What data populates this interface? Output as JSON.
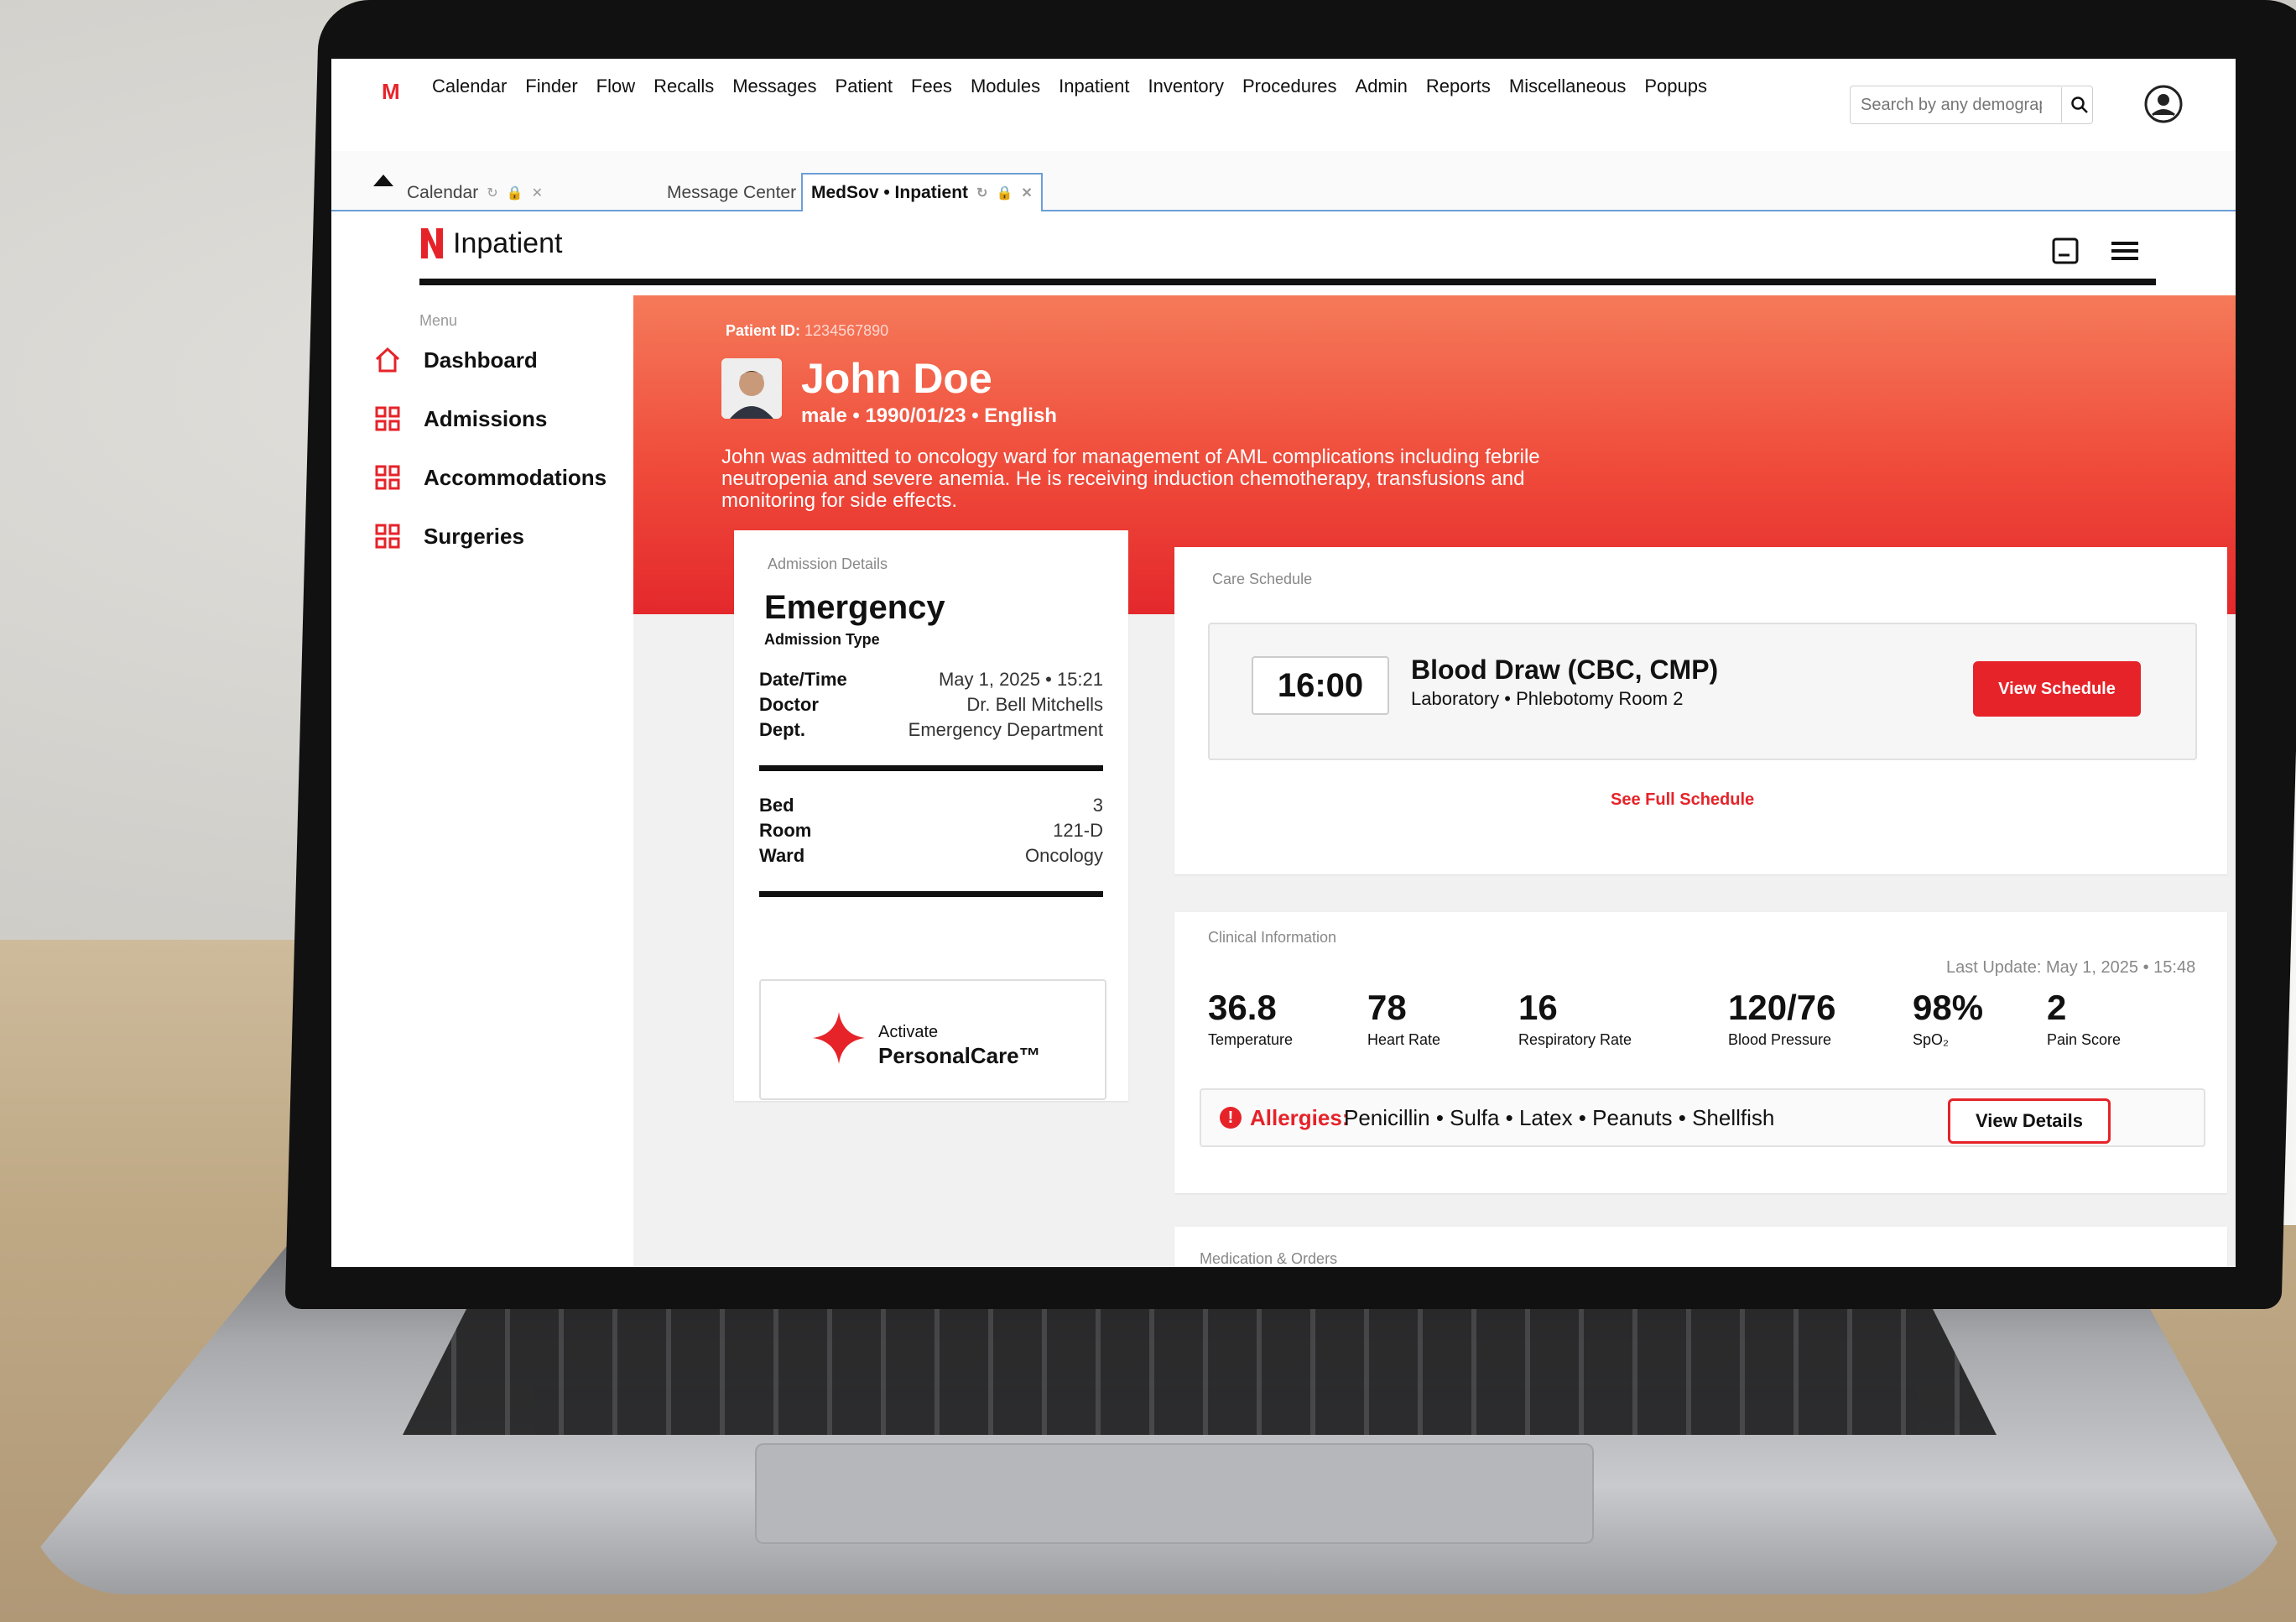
{
  "menu": [
    "Calendar",
    "Finder",
    "Flow",
    "Recalls",
    "Messages",
    "Patient",
    "Fees",
    "Modules",
    "Inpatient",
    "Inventory",
    "Procedures",
    "Admin",
    "Reports",
    "Miscellaneous",
    "Popups"
  ],
  "logo_letter": "M",
  "search": {
    "placeholder": "Search by any demograp"
  },
  "tabs": [
    {
      "label": "Calendar"
    },
    {
      "label": "Message Center"
    },
    {
      "label": "MedSov • Inpatient"
    }
  ],
  "brand": {
    "title": "Inpatient",
    "accent": "#e52329"
  },
  "sidebar": {
    "menu_label": "Menu",
    "items": [
      {
        "label": "Dashboard",
        "icon": "home-icon"
      },
      {
        "label": "Admissions",
        "icon": "grid-icon"
      },
      {
        "label": "Accommodations",
        "icon": "grid-icon"
      },
      {
        "label": "Surgeries",
        "icon": "grid-icon"
      }
    ]
  },
  "patient": {
    "id_label": "Patient ID:",
    "id": "1234567890",
    "name": "John Doe",
    "meta": "male • 1990/01/23 • English",
    "description": "John was admitted to oncology ward for management of AML complications including febrile neutropenia and severe anemia. He is receiving induction chemotherapy, transfusions and monitoring for side effects."
  },
  "admission": {
    "card_label": "Admission Details",
    "type": "Emergency",
    "type_label": "Admission Type",
    "rows1": [
      {
        "k": "Date/Time",
        "v": "May 1, 2025 • 15:21"
      },
      {
        "k": "Doctor",
        "v": "Dr. Bell Mitchells"
      },
      {
        "k": "Dept.",
        "v": "Emergency Department"
      }
    ],
    "rows2": [
      {
        "k": "Bed",
        "v": "3"
      },
      {
        "k": "Room",
        "v": "121-D"
      },
      {
        "k": "Ward",
        "v": "Oncology"
      }
    ],
    "activate_small": "Activate",
    "activate_big": "PersonalCare™"
  },
  "care": {
    "card_label": "Care Schedule",
    "time": "16:00",
    "title": "Blood Draw (CBC, CMP)",
    "subtitle": "Laboratory • Phlebotomy Room 2",
    "button": "View Schedule",
    "link": "See Full Schedule"
  },
  "clinical": {
    "card_label": "Clinical Information",
    "last_update": "Last Update: May 1, 2025 • 15:48",
    "vitals": [
      {
        "n": "36.8",
        "l": "Temperature"
      },
      {
        "n": "78",
        "l": "Heart Rate"
      },
      {
        "n": "16",
        "l": "Respiratory Rate"
      },
      {
        "n": "120/76",
        "l": "Blood Pressure"
      },
      {
        "n": "98%",
        "l": "SpO₂"
      },
      {
        "n": "2",
        "l": "Pain Score"
      }
    ],
    "allergy_label": "Allergies:",
    "allergies": "Penicillin • Sulfa • Latex • Peanuts • Shellfish",
    "button": "View Details"
  },
  "meds": {
    "card_label": "Medication & Orders"
  }
}
